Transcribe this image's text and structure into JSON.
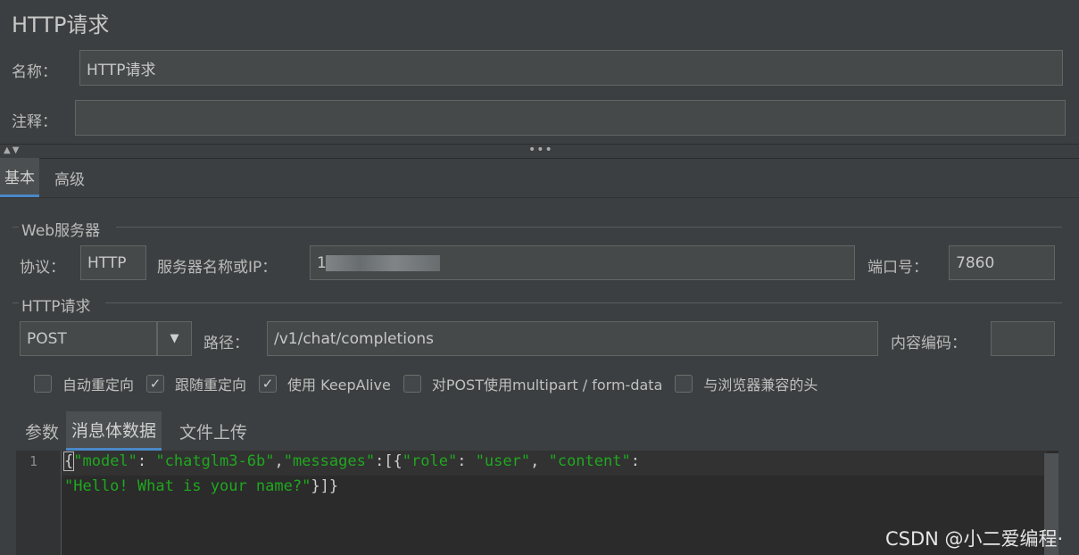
{
  "title": "HTTP请求",
  "name": {
    "label": "名称：",
    "value": "HTTP请求"
  },
  "comment": {
    "label": "注释：",
    "value": ""
  },
  "tabs": [
    "基本",
    "高级"
  ],
  "web_server": {
    "legend": "Web服务器",
    "protocol_label": "协议：",
    "protocol_value": "HTTP",
    "server_label": "服务器名称或IP：",
    "server_value": "1",
    "port_label": "端口号：",
    "port_value": "7860"
  },
  "http_request": {
    "legend": "HTTP请求",
    "method": "POST",
    "path_label": "路径：",
    "path_value": "/v1/chat/completions",
    "encoding_label": "内容编码：",
    "encoding_value": ""
  },
  "options": [
    {
      "label": "自动重定向",
      "checked": false
    },
    {
      "label": "跟随重定向",
      "checked": true
    },
    {
      "label": "使用 KeepAlive",
      "checked": true
    },
    {
      "label": "对POST使用multipart / form-data",
      "checked": false
    },
    {
      "label": "与浏览器兼容的头",
      "checked": false
    }
  ],
  "body_tabs": [
    "参数",
    "消息体数据",
    "文件上传"
  ],
  "editor": {
    "line_number": "1",
    "line1": {
      "b_open": "{",
      "k_model": "\"model\"",
      "p1": ": ",
      "v_model": "\"chatglm3-6b\"",
      "p2": ",",
      "k_messages": "\"messages\"",
      "p3": ":[{",
      "k_role": "\"role\"",
      "p4": ": ",
      "v_role": "\"user\"",
      "p5": ", ",
      "k_content": "\"content\"",
      "p6": ":"
    },
    "line2": {
      "v_content": "\"Hello! What is your name?\"",
      "close": "}]}"
    }
  },
  "watermark": "CSDN @小二爱编程·"
}
